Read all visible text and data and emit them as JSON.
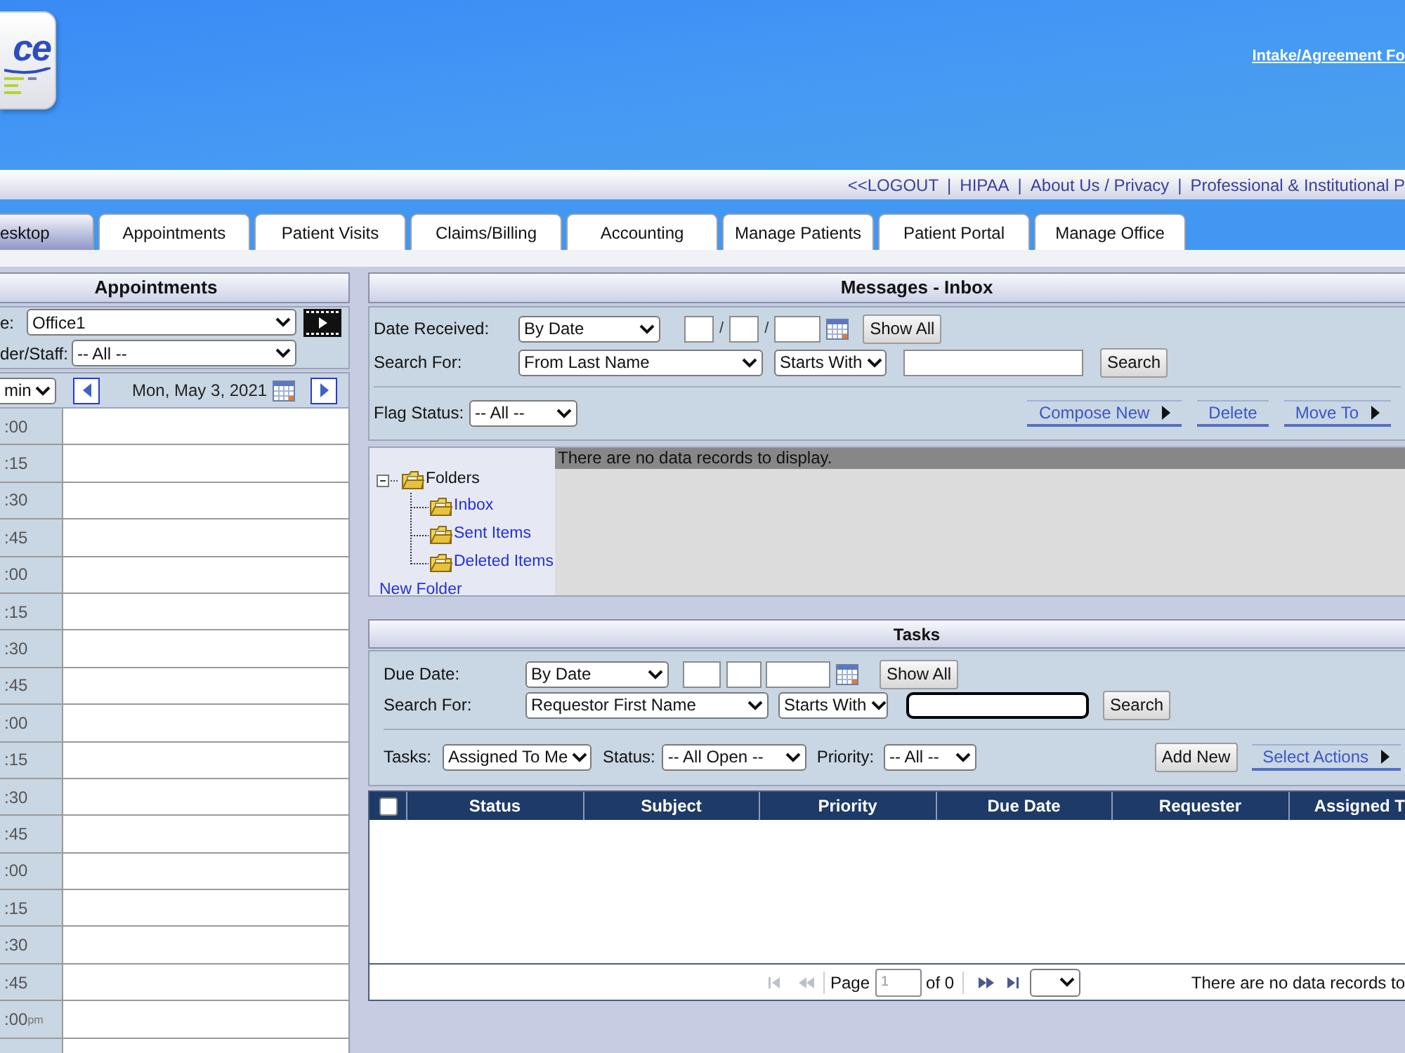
{
  "header": {
    "logo_text": "ce",
    "top_link": "Intake/Agreement Fo"
  },
  "nav_links": [
    {
      "label": "<<LOGOUT",
      "separator": "|"
    },
    {
      "label": "HIPAA",
      "separator": "|"
    },
    {
      "label": "About Us / Privacy",
      "separator": "|"
    },
    {
      "label": "Professional & Institutional P"
    }
  ],
  "tabs": [
    {
      "label": "esktop",
      "selected": true
    },
    {
      "label": "Appointments",
      "selected": false
    },
    {
      "label": "Patient Visits",
      "selected": false
    },
    {
      "label": "Claims/Billing",
      "selected": false
    },
    {
      "label": "Accounting",
      "selected": false
    },
    {
      "label": "Manage Patients",
      "selected": false
    },
    {
      "label": "Patient Portal",
      "selected": false
    },
    {
      "label": "Manage Office",
      "selected": false
    }
  ],
  "appointments": {
    "title": "Appointments",
    "location_label": "e:",
    "location_value": "Office1",
    "provider_label": "der/Staff:",
    "provider_value": "-- All --",
    "interval_value": "min",
    "date": "Mon, May 3, 2021",
    "slots": [
      {
        "time": ":00"
      },
      {
        "time": ":15"
      },
      {
        "time": ":30"
      },
      {
        "time": ":45"
      },
      {
        "time": ":00"
      },
      {
        "time": ":15"
      },
      {
        "time": ":30"
      },
      {
        "time": ":45"
      },
      {
        "time": ":00"
      },
      {
        "time": ":15"
      },
      {
        "time": ":30"
      },
      {
        "time": ":45"
      },
      {
        "time": ":00"
      },
      {
        "time": ":15"
      },
      {
        "time": ":30"
      },
      {
        "time": ":45"
      },
      {
        "time": ":00",
        "suffix": "pm"
      }
    ]
  },
  "messages": {
    "title": "Messages - Inbox",
    "date_label": "Date Received:",
    "date_mode": "By Date",
    "date_separators": [
      "/",
      "/"
    ],
    "show_all": "Show All",
    "search_label": "Search For:",
    "search_field": "From Last Name",
    "match_mode": "Starts With",
    "search_button": "Search",
    "flag_label": "Flag Status:",
    "flag_value": "-- All --",
    "actions": [
      {
        "label": "Compose New",
        "menu": true
      },
      {
        "label": "Delete",
        "menu": false
      },
      {
        "label": "Move To",
        "menu": true
      }
    ],
    "folders": {
      "label": "Folders",
      "expanded": true,
      "children": [
        {
          "label": "Inbox"
        },
        {
          "label": "Sent Items"
        },
        {
          "label": "Deleted Items"
        }
      ]
    },
    "new_folder": "New Folder",
    "empty_message": "There are no data records to display."
  },
  "tasks": {
    "title": "Tasks",
    "due_label": "Due Date:",
    "date_mode": "By Date",
    "show_all": "Show All",
    "search_label": "Search For:",
    "search_field": "Requestor First Name",
    "match_mode": "Starts With",
    "search_focused": true,
    "search_button": "Search",
    "tasks_label": "Tasks:",
    "tasks_value": "Assigned To Me",
    "status_label": "Status:",
    "status_value": "-- All Open --",
    "priority_label": "Priority:",
    "priority_value": "-- All --",
    "add_button": "Add New",
    "actions_link": {
      "label": "Select Actions",
      "menu": true
    },
    "select_all_checked": false,
    "columns": [
      "Status",
      "Subject",
      "Priority",
      "Due Date",
      "Requester",
      "Assigned T"
    ],
    "pager": {
      "buttons": [
        {
          "kind": "first",
          "disabled": true
        },
        {
          "kind": "prev",
          "disabled": true
        },
        {
          "kind": "next",
          "disabled": false
        },
        {
          "kind": "last",
          "disabled": false
        }
      ],
      "page_label": "Page",
      "page_value": "1",
      "of_label": "of 0",
      "empty_message": "There are no data records to"
    }
  }
}
